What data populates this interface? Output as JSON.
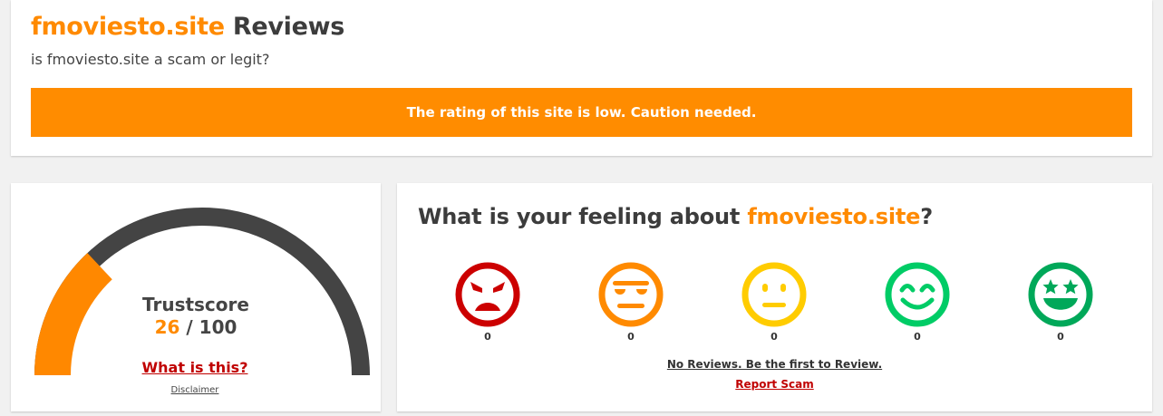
{
  "header": {
    "site_name": "fmoviesto.site",
    "title_suffix": " Reviews",
    "subtitle": "is fmoviesto.site a scam or legit?",
    "banner": "The rating of this site is low. Caution needed."
  },
  "trustscore": {
    "label": "Trustscore",
    "score": "26",
    "max": " / 100",
    "value": 26,
    "max_value": 100,
    "what_link": "What is this?",
    "disclaimer": "Disclaimer",
    "colors": {
      "fill": "#ff8800",
      "track": "#444444"
    }
  },
  "feeling": {
    "title_prefix": "What is your feeling about ",
    "site_name": "fmoviesto.site",
    "title_suffix": "?",
    "emojis": [
      {
        "icon": "angry-face-icon",
        "count": "0",
        "color": "#cc0000"
      },
      {
        "icon": "unamused-face-icon",
        "count": "0",
        "color": "#ff8a00"
      },
      {
        "icon": "neutral-face-icon",
        "count": "0",
        "color": "#ffcc00"
      },
      {
        "icon": "smiling-face-icon",
        "count": "0",
        "color": "#00cc66"
      },
      {
        "icon": "star-eyes-face-icon",
        "count": "0",
        "color": "#00a859"
      }
    ],
    "no_reviews": "No Reviews. Be the first to Review.",
    "report": "Report Scam"
  }
}
